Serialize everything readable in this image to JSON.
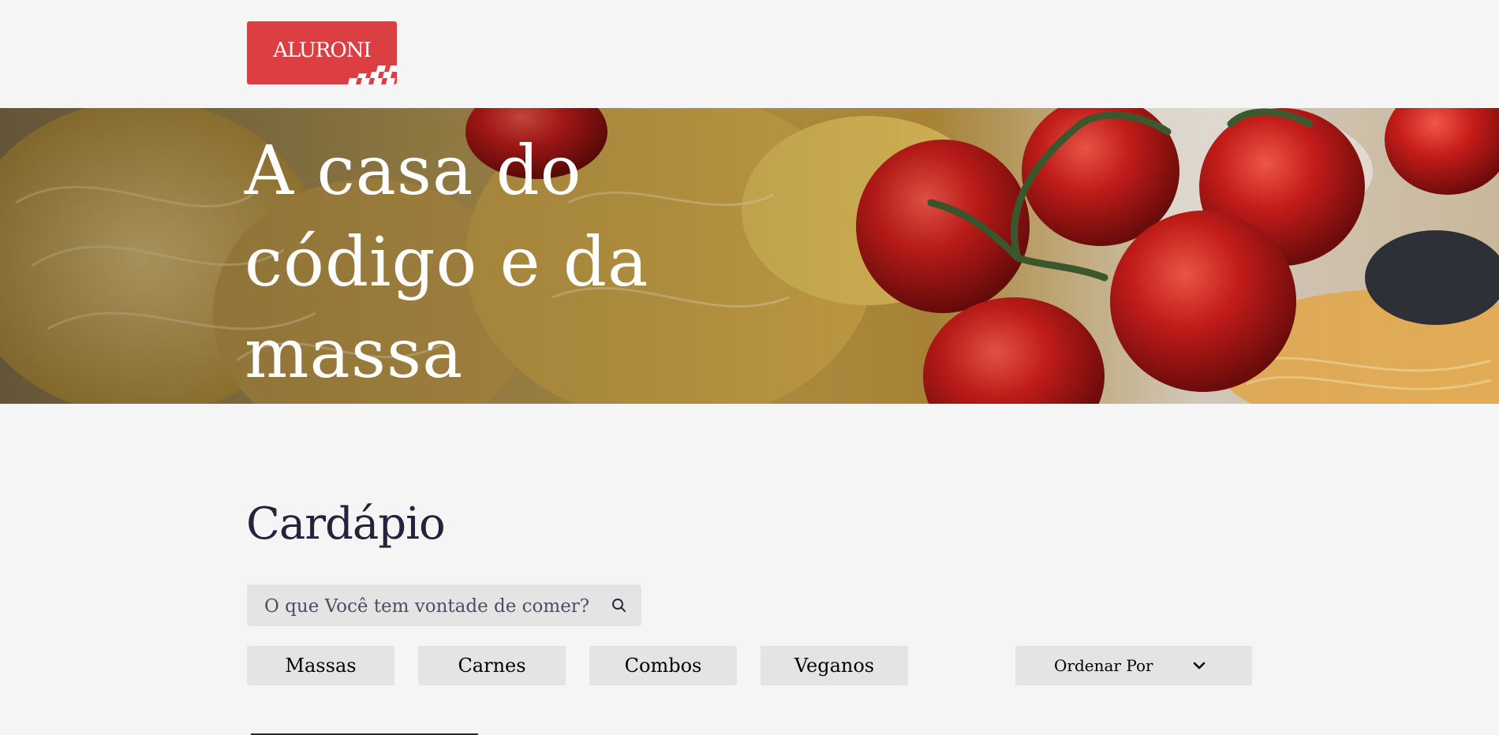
{
  "brand": {
    "logo_text": "ALURONI",
    "accent_color": "#dc3f41"
  },
  "hero": {
    "title": "A casa do código e da massa"
  },
  "menu": {
    "title": "Cardápio",
    "search": {
      "placeholder": "O que Você tem vontade de comer?",
      "value": "",
      "icon": "search-icon"
    },
    "filters": [
      {
        "label": "Massas"
      },
      {
        "label": "Carnes"
      },
      {
        "label": "Combos"
      },
      {
        "label": "Veganos"
      }
    ],
    "sort": {
      "label": "Ordenar Por",
      "icon": "chevron-down-icon"
    }
  },
  "colors": {
    "background": "#f5f5f5",
    "control_bg": "#e4e4e4",
    "heading": "#23233a"
  }
}
